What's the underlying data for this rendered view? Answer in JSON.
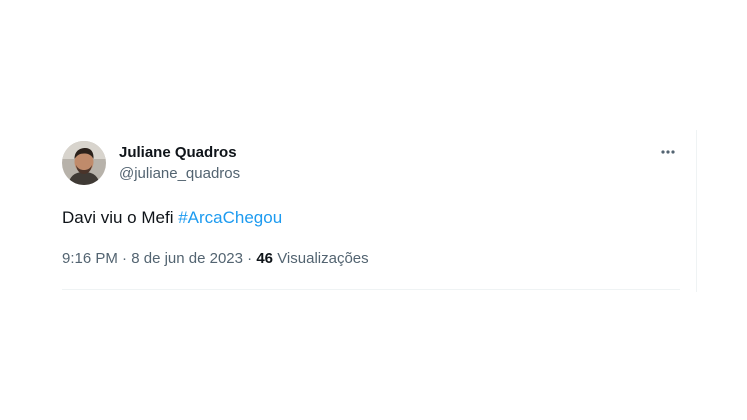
{
  "tweet": {
    "author": {
      "display_name": "Juliane Quadros",
      "handle": "@juliane_quadros"
    },
    "text_prefix": "Davi viu o Mefi ",
    "hashtag": "#ArcaChegou",
    "timestamp": "9:16 PM",
    "separator": " · ",
    "date": "8 de jun de 2023",
    "views_count": "46",
    "views_label": " Visualizações"
  },
  "icons": {
    "more": "more-horizontal-icon",
    "avatar": "avatar"
  },
  "colors": {
    "text": "#0f1419",
    "secondary": "#536471",
    "link": "#1d9bf0",
    "divider": "#eff3f4"
  }
}
